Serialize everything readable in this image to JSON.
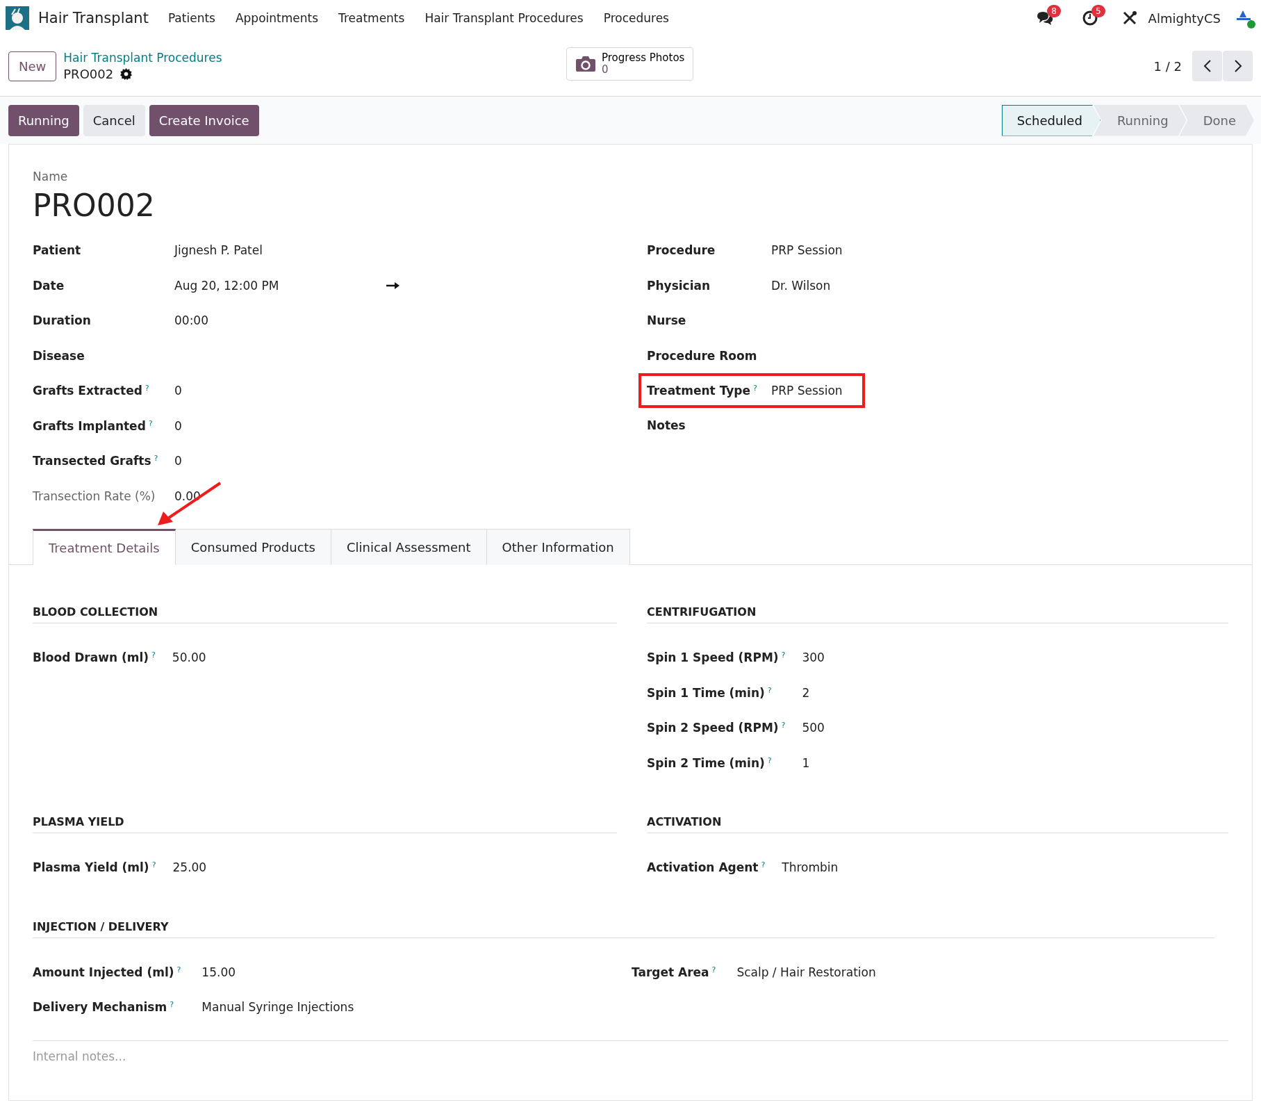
{
  "navbar": {
    "app_name": "Hair Transplant",
    "menu": [
      "Patients",
      "Appointments",
      "Treatments",
      "Hair Transplant Procedures",
      "Procedures"
    ],
    "messages_badge": "8",
    "activities_badge": "5",
    "user": "AlmightyCS"
  },
  "control_panel": {
    "new_button": "New",
    "breadcrumb": "Hair Transplant Procedures",
    "record": "PRO002",
    "smart_button": {
      "label": "Progress Photos",
      "count": "0"
    },
    "pager": "1 / 2"
  },
  "actions": [
    {
      "label": "Running",
      "kind": "primary"
    },
    {
      "label": "Cancel",
      "kind": "secondary"
    },
    {
      "label": "Create Invoice",
      "kind": "primary"
    }
  ],
  "statusbar": [
    {
      "label": "Scheduled",
      "selected": true
    },
    {
      "label": "Running",
      "selected": false
    },
    {
      "label": "Done",
      "selected": false
    }
  ],
  "form": {
    "name_label": "Name",
    "title": "PRO002",
    "left_fields": [
      {
        "label": "Patient",
        "value": "Jignesh P. Patel",
        "kind": "text",
        "muted": false
      },
      {
        "label": "Date",
        "value": "Aug 20, 12:00 PM",
        "kind": "daterange",
        "muted": false
      },
      {
        "label": "Duration",
        "value": "00:00",
        "kind": "text",
        "muted": false
      },
      {
        "label": "Disease",
        "kind": "text",
        "muted": false
      },
      {
        "label": "Grafts Extracted",
        "help": "?",
        "value": "0",
        "kind": "text",
        "muted": false
      },
      {
        "label": "Grafts Implanted",
        "help": "?",
        "value": "0",
        "kind": "text",
        "muted": false
      },
      {
        "label": "Transected Grafts",
        "help": "?",
        "value": "0",
        "kind": "text",
        "muted": false
      },
      {
        "label": "Transection Rate (%)",
        "value": "0.00",
        "kind": "text",
        "muted": true
      }
    ],
    "right_fields": [
      {
        "label": "Procedure",
        "value": "PRP Session",
        "highlighted": false
      },
      {
        "label": "Physician",
        "value": "Dr. Wilson",
        "highlighted": false
      },
      {
        "label": "Nurse",
        "highlighted": false
      },
      {
        "label": "Procedure Room",
        "highlighted": false
      },
      {
        "label": "Treatment Type",
        "help": "?",
        "value": "PRP Session",
        "highlighted": true
      },
      {
        "label": "Notes",
        "highlighted": false
      }
    ]
  },
  "tabs": [
    {
      "label": "Treatment Details",
      "selected": true
    },
    {
      "label": "Consumed Products",
      "selected": false
    },
    {
      "label": "Clinical Assessment",
      "selected": false
    },
    {
      "label": "Other Information",
      "selected": false
    }
  ],
  "sections": [
    {
      "title": "BLOOD COLLECTION",
      "fields": [
        {
          "label": "Blood Drawn (ml)",
          "help": "?",
          "value": "50.00"
        }
      ]
    },
    {
      "title": "CENTRIFUGATION",
      "fields": [
        {
          "label": "Spin 1 Speed (RPM)",
          "help": "?",
          "value": "300"
        },
        {
          "label": "Spin 1 Time (min)",
          "help": "?",
          "value": "2"
        },
        {
          "label": "Spin 2 Speed (RPM)",
          "help": "?",
          "value": "500"
        },
        {
          "label": "Spin 2 Time (min)",
          "help": "?",
          "value": "1"
        }
      ]
    },
    {
      "title": "PLASMA YIELD",
      "fields": [
        {
          "label": "Plasma Yield (ml)",
          "help": "?",
          "value": "25.00"
        }
      ]
    },
    {
      "title": "ACTIVATION",
      "fields": [
        {
          "label": "Activation Agent",
          "help": "?",
          "value": "Thrombin"
        }
      ]
    }
  ],
  "injection": {
    "title": "INJECTION / DELIVERY",
    "left": [
      {
        "label": "Amount Injected (ml)",
        "help": "?",
        "value": "15.00"
      },
      {
        "label": "Delivery Mechanism",
        "help": "?",
        "value": "Manual Syringe Injections"
      }
    ],
    "right": [
      {
        "label": "Target Area",
        "help": "?",
        "value": "Scalp / Hair Restoration"
      }
    ]
  },
  "notes": {
    "placeholder": "Internal notes..."
  }
}
